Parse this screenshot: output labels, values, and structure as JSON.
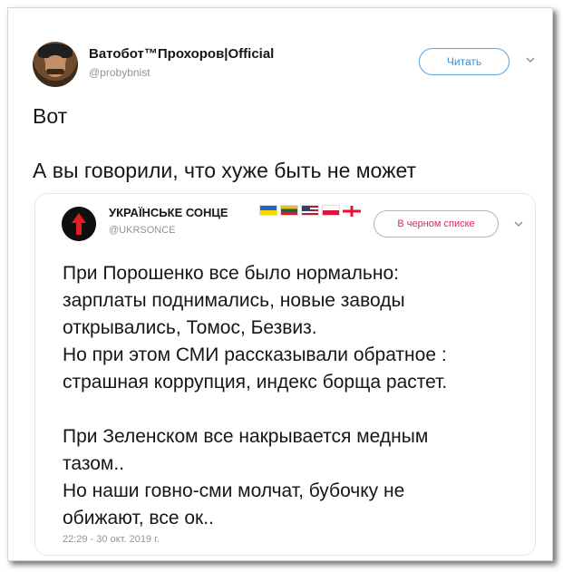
{
  "tweet": {
    "author_name": "Ватобот™Прохоров|Official",
    "author_handle": "@probybnist",
    "follow_label": "Читать",
    "lines": [
      "Вот",
      "А вы говорили, что хуже быть не может"
    ]
  },
  "quoted": {
    "author_name": "УКРАЇНСЬКЕ СОНЦЕ",
    "author_handle": "@UKRSONCE",
    "status_button": "В черном списке",
    "flags": [
      "ukraine-flag",
      "lithuania-flag",
      "usa-flag",
      "poland-flag",
      "georgia-flag"
    ],
    "paragraphs": [
      [
        "При Порошенко все было нормально:",
        "зарплаты поднимались, новые заводы",
        "открывались, Томос, Безвиз.",
        "Но при этом СМИ рассказывали обратное :",
        "страшная коррупция, индекс борща растет."
      ],
      [
        "При Зеленском все накрывается медным",
        "тазом..",
        "Но наши говно-сми молчат, бубочку не",
        "обижают, все ок.."
      ]
    ],
    "timestamp": "22:29 - 30 окт. 2019 г."
  },
  "colors": {
    "follow_blue": "#3b8ed6",
    "blocked_red": "#e0245e",
    "muted_gray": "#8a959e"
  }
}
